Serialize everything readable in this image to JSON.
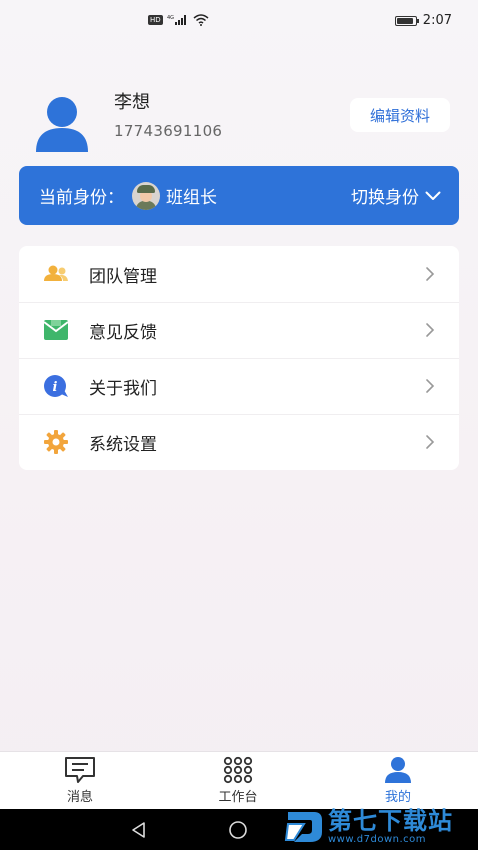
{
  "status_bar": {
    "network": "HD 4G",
    "time": "2:07",
    "battery_level": 0.9
  },
  "profile": {
    "name": "李想",
    "phone": "17743691106",
    "edit_label": "编辑资料"
  },
  "identity": {
    "prefix": "当前身份：",
    "role": "班组长",
    "switch_label": "切换身份"
  },
  "menu": [
    {
      "label": "团队管理",
      "icon": "team-icon"
    },
    {
      "label": "意见反馈",
      "icon": "feedback-mail-icon"
    },
    {
      "label": "关于我们",
      "icon": "info-bubble-icon"
    },
    {
      "label": "系统设置",
      "icon": "gear-icon"
    }
  ],
  "bottom_nav": [
    {
      "label": "消息",
      "icon": "message-icon",
      "active": false
    },
    {
      "label": "工作台",
      "icon": "grid-dots-icon",
      "active": false
    },
    {
      "label": "我的",
      "icon": "person-icon",
      "active": true
    }
  ],
  "watermark": {
    "title": "第七下载站",
    "url": "www.d7down.com"
  },
  "colors": {
    "accent": "#2e73d9",
    "team_icon": "#f2b13c",
    "feedback_icon": "#3fb66b",
    "info_icon": "#3b6fe0",
    "gear_icon": "#f2a53c"
  }
}
